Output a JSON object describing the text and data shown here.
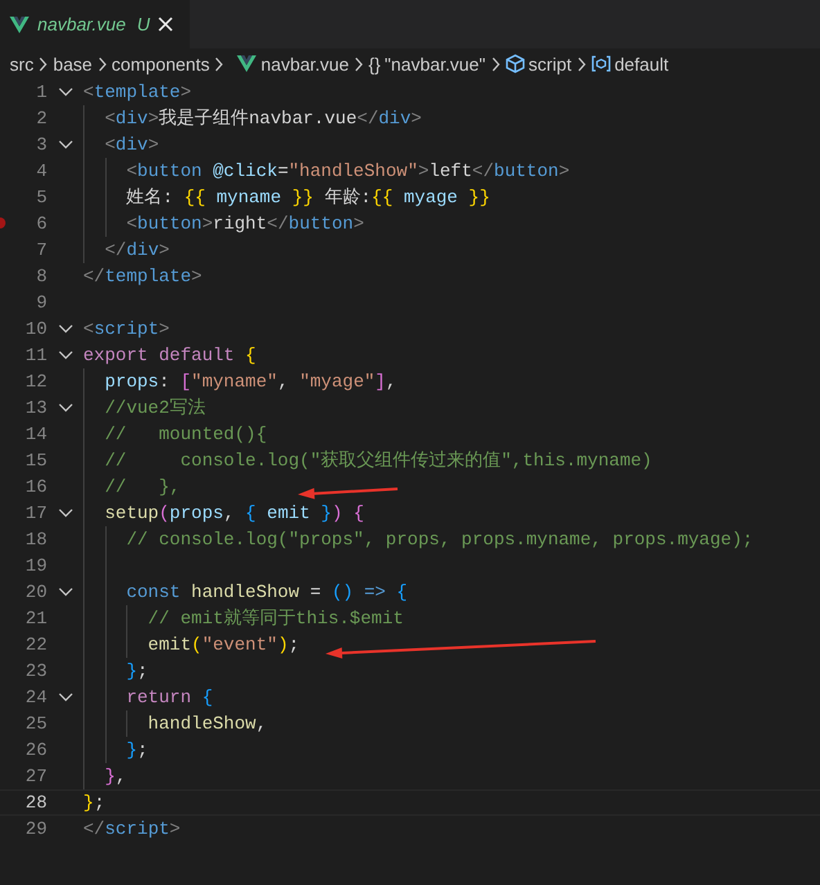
{
  "tab": {
    "label": "navbar.vue",
    "status": "U",
    "selected": true
  },
  "breadcrumb": [
    {
      "kind": "folder",
      "label": "src"
    },
    {
      "kind": "folder",
      "label": "base"
    },
    {
      "kind": "folder",
      "label": "components"
    },
    {
      "kind": "vue",
      "label": "navbar.vue"
    },
    {
      "kind": "braces",
      "glyph": "{}",
      "label": "\"navbar.vue\""
    },
    {
      "kind": "module",
      "label": "script"
    },
    {
      "kind": "field",
      "label": "default"
    }
  ],
  "lines": [
    {
      "n": "1",
      "fold": true,
      "bp": false,
      "arrow": false,
      "current": false,
      "tokens": [
        {
          "text": "<",
          "kind": "p"
        },
        {
          "text": "template",
          "kind": "tag"
        },
        {
          "text": ">",
          "kind": "p"
        }
      ]
    },
    {
      "n": "2",
      "fold": false,
      "bp": false,
      "arrow": false,
      "current": false,
      "tokens": [
        {
          "text": "  <",
          "kind": "p"
        },
        {
          "text": "div",
          "kind": "tag"
        },
        {
          "text": ">",
          "kind": "p"
        },
        {
          "text": "我是子组件navbar.vue",
          "kind": "t"
        },
        {
          "text": "</",
          "kind": "p"
        },
        {
          "text": "div",
          "kind": "tag"
        },
        {
          "text": ">",
          "kind": "p"
        }
      ]
    },
    {
      "n": "3",
      "fold": true,
      "bp": false,
      "arrow": false,
      "current": false,
      "tokens": [
        {
          "text": "  <",
          "kind": "p"
        },
        {
          "text": "div",
          "kind": "tag"
        },
        {
          "text": ">",
          "kind": "p"
        }
      ]
    },
    {
      "n": "4",
      "fold": false,
      "bp": false,
      "arrow": false,
      "current": false,
      "tokens": [
        {
          "text": "    <",
          "kind": "p"
        },
        {
          "text": "button",
          "kind": "tag"
        },
        {
          "text": " @click",
          "kind": "attr"
        },
        {
          "text": "=",
          "kind": "t"
        },
        {
          "text": "\"handleShow\"",
          "kind": "str"
        },
        {
          "text": ">",
          "kind": "p"
        },
        {
          "text": "left",
          "kind": "t"
        },
        {
          "text": "</",
          "kind": "p"
        },
        {
          "text": "button",
          "kind": "tag"
        },
        {
          "text": ">",
          "kind": "p"
        }
      ]
    },
    {
      "n": "5",
      "fold": false,
      "bp": false,
      "arrow": false,
      "current": false,
      "tokens": [
        {
          "text": "    姓名: ",
          "kind": "t"
        },
        {
          "text": "{{",
          "kind": "b1"
        },
        {
          "text": " myname ",
          "kind": "var"
        },
        {
          "text": "}}",
          "kind": "b1"
        },
        {
          "text": " 年龄:",
          "kind": "t"
        },
        {
          "text": "{{",
          "kind": "b1"
        },
        {
          "text": " myage ",
          "kind": "var"
        },
        {
          "text": "}}",
          "kind": "b1"
        }
      ]
    },
    {
      "n": "6",
      "fold": false,
      "bp": true,
      "arrow": false,
      "current": false,
      "tokens": [
        {
          "text": "    <",
          "kind": "p"
        },
        {
          "text": "button",
          "kind": "tag"
        },
        {
          "text": ">",
          "kind": "p"
        },
        {
          "text": "right",
          "kind": "t"
        },
        {
          "text": "</",
          "kind": "p"
        },
        {
          "text": "button",
          "kind": "tag"
        },
        {
          "text": ">",
          "kind": "p"
        }
      ]
    },
    {
      "n": "7",
      "fold": false,
      "bp": false,
      "arrow": false,
      "current": false,
      "tokens": [
        {
          "text": "  </",
          "kind": "p"
        },
        {
          "text": "div",
          "kind": "tag"
        },
        {
          "text": ">",
          "kind": "p"
        }
      ]
    },
    {
      "n": "8",
      "fold": false,
      "bp": false,
      "arrow": false,
      "current": false,
      "tokens": [
        {
          "text": "</",
          "kind": "p"
        },
        {
          "text": "template",
          "kind": "tag"
        },
        {
          "text": ">",
          "kind": "p"
        }
      ]
    },
    {
      "n": "9",
      "fold": false,
      "bp": false,
      "arrow": false,
      "current": false
    },
    {
      "n": "10",
      "fold": true,
      "bp": false,
      "arrow": false,
      "current": false,
      "tokens": [
        {
          "text": "<",
          "kind": "p"
        },
        {
          "text": "script",
          "kind": "tag"
        },
        {
          "text": ">",
          "kind": "p"
        }
      ]
    },
    {
      "n": "11",
      "fold": true,
      "bp": false,
      "arrow": false,
      "current": false,
      "tokens": [
        {
          "text": "export default ",
          "kind": "kw"
        },
        {
          "text": "{",
          "kind": "b1"
        }
      ]
    },
    {
      "n": "12",
      "fold": false,
      "bp": false,
      "arrow": false,
      "current": false,
      "tokens": [
        {
          "text": "  props",
          "kind": "var"
        },
        {
          "text": ": ",
          "kind": "t"
        },
        {
          "text": "[",
          "kind": "b2"
        },
        {
          "text": "\"myname\"",
          "kind": "str"
        },
        {
          "text": ", ",
          "kind": "t"
        },
        {
          "text": "\"myage\"",
          "kind": "str"
        },
        {
          "text": "]",
          "kind": "b2"
        },
        {
          "text": ",",
          "kind": "t"
        }
      ]
    },
    {
      "n": "13",
      "fold": true,
      "bp": false,
      "arrow": false,
      "current": false,
      "tokens": [
        {
          "text": "  //vue2写法",
          "kind": "cm"
        }
      ]
    },
    {
      "n": "14",
      "fold": false,
      "bp": false,
      "arrow": false,
      "current": false,
      "tokens": [
        {
          "text": "  //   mounted(){",
          "kind": "cm"
        }
      ]
    },
    {
      "n": "15",
      "fold": false,
      "bp": false,
      "arrow": false,
      "current": false,
      "tokens": [
        {
          "text": "  //     console.log(\"获取父组件传过来的值\",this.myname)",
          "kind": "cm"
        }
      ]
    },
    {
      "n": "16",
      "fold": false,
      "bp": false,
      "arrow": true,
      "current": false,
      "tokens": [
        {
          "text": "  //   },",
          "kind": "cm"
        }
      ]
    },
    {
      "n": "17",
      "fold": true,
      "bp": false,
      "arrow": false,
      "current": false,
      "tokens": [
        {
          "text": "  setup",
          "kind": "fn"
        },
        {
          "text": "(",
          "kind": "b2"
        },
        {
          "text": "props",
          "kind": "var"
        },
        {
          "text": ", ",
          "kind": "t"
        },
        {
          "text": "{",
          "kind": "b3"
        },
        {
          "text": " emit ",
          "kind": "var"
        },
        {
          "text": "}",
          "kind": "b3"
        },
        {
          "text": ")",
          "kind": "b2"
        },
        {
          "text": " {",
          "kind": "b2"
        }
      ]
    },
    {
      "n": "18",
      "fold": false,
      "bp": false,
      "arrow": false,
      "current": false,
      "tokens": [
        {
          "text": "    // console.log(\"props\", props, props.myname, props.myage);",
          "kind": "cm"
        }
      ]
    },
    {
      "n": "19",
      "fold": false,
      "bp": false,
      "arrow": false,
      "current": false
    },
    {
      "n": "20",
      "fold": true,
      "bp": false,
      "arrow": false,
      "current": false,
      "tokens": [
        {
          "text": "    const",
          "kind": "kw2"
        },
        {
          "text": " handleShow",
          "kind": "fn"
        },
        {
          "text": " = ",
          "kind": "t"
        },
        {
          "text": "()",
          "kind": "b3"
        },
        {
          "text": " => ",
          "kind": "kw2"
        },
        {
          "text": "{",
          "kind": "b3"
        }
      ]
    },
    {
      "n": "21",
      "fold": false,
      "bp": false,
      "arrow": false,
      "current": false,
      "tokens": [
        {
          "text": "      // emit就等同于this.$emit",
          "kind": "cm"
        }
      ]
    },
    {
      "n": "22",
      "fold": false,
      "bp": false,
      "arrow": true,
      "current": false,
      "tokens": [
        {
          "text": "      emit",
          "kind": "fn"
        },
        {
          "text": "(",
          "kind": "b1"
        },
        {
          "text": "\"event\"",
          "kind": "str"
        },
        {
          "text": ")",
          "kind": "b1"
        },
        {
          "text": ";",
          "kind": "t"
        }
      ]
    },
    {
      "n": "23",
      "fold": false,
      "bp": false,
      "arrow": false,
      "current": false,
      "tokens": [
        {
          "text": "    }",
          "kind": "b3"
        },
        {
          "text": ";",
          "kind": "t"
        }
      ]
    },
    {
      "n": "24",
      "fold": true,
      "bp": false,
      "arrow": false,
      "current": false,
      "tokens": [
        {
          "text": "    return ",
          "kind": "kw"
        },
        {
          "text": "{",
          "kind": "b3"
        }
      ]
    },
    {
      "n": "25",
      "fold": false,
      "bp": false,
      "arrow": false,
      "current": false,
      "tokens": [
        {
          "text": "      handleShow",
          "kind": "fn"
        },
        {
          "text": ",",
          "kind": "t"
        }
      ]
    },
    {
      "n": "26",
      "fold": false,
      "bp": false,
      "arrow": false,
      "current": false,
      "tokens": [
        {
          "text": "    }",
          "kind": "b3"
        },
        {
          "text": ";",
          "kind": "t"
        }
      ]
    },
    {
      "n": "27",
      "fold": false,
      "bp": false,
      "arrow": false,
      "current": false,
      "tokens": [
        {
          "text": "  }",
          "kind": "b2"
        },
        {
          "text": ",",
          "kind": "t"
        }
      ]
    },
    {
      "n": "28",
      "fold": false,
      "bp": false,
      "arrow": false,
      "current": true,
      "tokens": [
        {
          "text": "}",
          "kind": "b1"
        },
        {
          "text": ";",
          "kind": "t"
        }
      ]
    },
    {
      "n": "29",
      "fold": false,
      "bp": false,
      "arrow": false,
      "current": false,
      "tokens": [
        {
          "text": "</",
          "kind": "p"
        },
        {
          "text": "script",
          "kind": "tag"
        },
        {
          "text": ">",
          "kind": "p"
        }
      ]
    }
  ]
}
